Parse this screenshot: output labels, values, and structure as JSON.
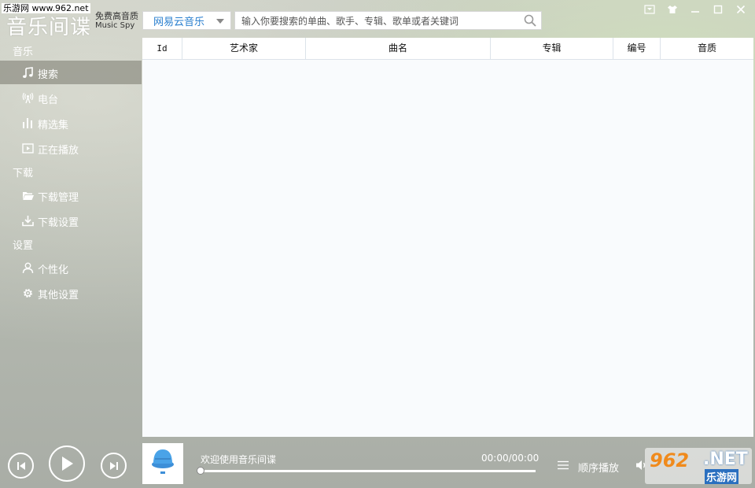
{
  "watermark": {
    "top_left": "乐游网 www.962.net",
    "badge_number": "962",
    "badge_net": ".NET",
    "badge_cn": "乐游网"
  },
  "app": {
    "title": "音乐间谍",
    "subtitle_cn": "免费高音质",
    "subtitle_en": "Music Spy"
  },
  "toolbar": {
    "source": "网易云音乐",
    "search_placeholder": "输入你要搜索的单曲、歌手、专辑、歌单或者关键词"
  },
  "window_controls": [
    "menu-icon",
    "skin-icon",
    "minimize-icon",
    "maximize-icon",
    "close-icon"
  ],
  "sidebar": {
    "sections": [
      {
        "title": "音乐",
        "items": [
          {
            "label": "搜索",
            "icon": "music-note-icon",
            "active": true
          },
          {
            "label": "电台",
            "icon": "radio-icon"
          },
          {
            "label": "精选集",
            "icon": "bars-icon"
          },
          {
            "label": "正在播放",
            "icon": "play-screen-icon"
          }
        ]
      },
      {
        "title": "下载",
        "items": [
          {
            "label": "下载管理",
            "icon": "folder-icon"
          },
          {
            "label": "下载设置",
            "icon": "download-icon"
          }
        ]
      },
      {
        "title": "设置",
        "items": [
          {
            "label": "个性化",
            "icon": "user-icon"
          },
          {
            "label": "其他设置",
            "icon": "gear-icon"
          }
        ]
      }
    ]
  },
  "table": {
    "columns": [
      "Id",
      "艺术家",
      "曲名",
      "专辑",
      "编号",
      "音质"
    ],
    "rows": []
  },
  "player": {
    "now_playing": "欢迎使用音乐间谍",
    "time": "00:00/00:00",
    "progress": 0,
    "play_mode": "顺序播放"
  },
  "colors": {
    "accent": "#2a7fcf",
    "sidebar_active": "#7a7a6e",
    "badge_orange": "#f08a1c"
  }
}
